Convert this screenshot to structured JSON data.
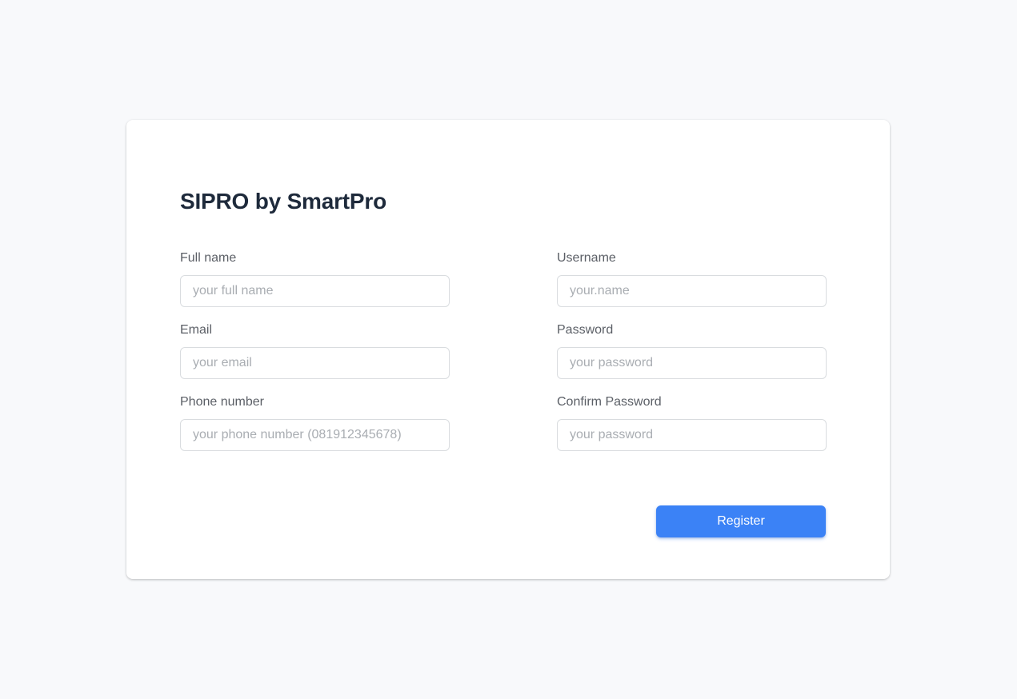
{
  "title": "SIPRO by SmartPro",
  "fields": {
    "full_name": {
      "label": "Full name",
      "placeholder": "your full name",
      "value": ""
    },
    "username": {
      "label": "Username",
      "placeholder": "your.name",
      "value": ""
    },
    "email": {
      "label": "Email",
      "placeholder": "your email",
      "value": ""
    },
    "password": {
      "label": "Password",
      "placeholder": "your password",
      "value": ""
    },
    "phone": {
      "label": "Phone number",
      "placeholder": "your phone number (081912345678)",
      "value": ""
    },
    "confirm_password": {
      "label": "Confirm Password",
      "placeholder": "your password",
      "value": ""
    }
  },
  "register_button": {
    "label": "Register"
  },
  "colors": {
    "accent": "#3b82f6",
    "background": "#f8f9fb",
    "title": "#1e2a3b"
  }
}
